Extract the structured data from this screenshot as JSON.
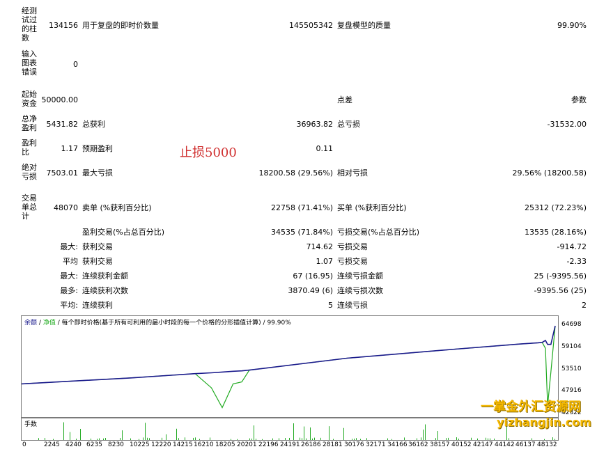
{
  "stats": {
    "bars_tested_label": "经测试过的柱数",
    "bars_tested_value": "134156",
    "ticks_label": "用于复盘的即时价数量",
    "ticks_value": "145505342",
    "quality_label": "复盘模型的质量",
    "quality_value": "99.90%",
    "chart_errors_label": "输入图表错误",
    "chart_errors_value": "0",
    "initial_deposit_label": "起始资金",
    "initial_deposit_value": "50000.00",
    "spread_label": "点差",
    "spread_value": "参数",
    "net_profit_label": "总净盈利",
    "net_profit_value": "5431.82",
    "gross_profit_label": "总获利",
    "gross_profit_value": "36963.82",
    "gross_loss_label": "总亏损",
    "gross_loss_value": "-31532.00",
    "profit_factor_label": "盈利比",
    "profit_factor_value": "1.17",
    "expected_payoff_label": "预期盈利",
    "expected_payoff_value": "0.11",
    "abs_drawdown_label": "绝对亏损",
    "abs_drawdown_value": "7503.01",
    "max_drawdown_label": "最大亏损",
    "max_drawdown_value": "18200.58 (29.56%)",
    "rel_drawdown_label": "相对亏损",
    "rel_drawdown_value": "29.56% (18200.58)",
    "total_trades_label": "交易单总计",
    "total_trades_value": "48070",
    "short_label": "卖单 (%获利百分比)",
    "short_value": "22758 (71.41%)",
    "long_label": "买单 (%获利百分比)",
    "long_value": "25312 (72.23%)",
    "profit_trades_label": "盈利交易(%占总百分比)",
    "profit_trades_value": "34535 (71.84%)",
    "loss_trades_label": "亏损交易(%占总百分比)",
    "loss_trades_value": "13535 (28.16%)",
    "largest_prefix": "最大:",
    "largest_profit_label": "获利交易",
    "largest_profit_value": "714.62",
    "largest_loss_label": "亏损交易",
    "largest_loss_value": "-914.72",
    "average_prefix": "平均",
    "average_profit_label": "获利交易",
    "average_profit_value": "1.07",
    "average_loss_label": "亏损交易",
    "average_loss_value": "-2.33",
    "max_cons_prefix": "最大:",
    "max_cons_wins_label": "连续获利金额",
    "max_cons_wins_value": "67 (16.95)",
    "max_cons_losses_label": "连续亏损金额",
    "max_cons_losses_value": "25 (-9395.56)",
    "maximal_prefix": "最多:",
    "maximal_cons_profit_label": "连续获利次数",
    "maximal_cons_profit_value": "3870.49 (6)",
    "maximal_cons_loss_label": "连续亏损次数",
    "maximal_cons_loss_value": "-9395.56 (25)",
    "avg_cons_prefix": "平均:",
    "avg_cons_wins_label": "连续获利",
    "avg_cons_wins_value": "5",
    "avg_cons_losses_label": "连续亏损",
    "avg_cons_losses_value": "2"
  },
  "annotation": "止损5000",
  "chart": {
    "legend_balance": "余额",
    "legend_sep1": "/",
    "legend_equity": "净值",
    "legend_sep2": "/",
    "legend_model": "每个即时价格(基于所有可利用的最小时段的每一个价格的分形插值计算)",
    "legend_sep3": "/",
    "legend_quality": "99.90%",
    "volume_label": "手数",
    "colors": {
      "balance": "#1a1a8c",
      "equity": "#1faa1f",
      "volume": "#22aa22"
    }
  },
  "chart_data": {
    "type": "line",
    "title": "",
    "x": [
      0,
      10000,
      16000,
      17500,
      18500,
      19500,
      20300,
      21000,
      30000,
      40000,
      46000,
      47600,
      48000,
      48300,
      48500,
      48800,
      49200
    ],
    "series": [
      {
        "name": "余额",
        "values": [
          50000,
          51500,
          52600,
          52800,
          53000,
          53200,
          53300,
          53500,
          56500,
          58800,
          60100,
          60400,
          60500,
          61000,
          60000,
          60000,
          64698
        ]
      },
      {
        "name": "净值",
        "values": [
          50000,
          51500,
          52600,
          49000,
          44000,
          50000,
          50500,
          53500,
          56500,
          58800,
          60100,
          60400,
          60500,
          59000,
          44500,
          53000,
          64698
        ]
      }
    ],
    "yticks": [
      "64698",
      "59104",
      "53510",
      "47916",
      "42322"
    ],
    "xticks": [
      "0",
      "2245",
      "4240",
      "6235",
      "8230",
      "10225",
      "12220",
      "14215",
      "16210",
      "18205",
      "20201",
      "22196",
      "24191",
      "26186",
      "28181",
      "30176",
      "32171",
      "34166",
      "36162",
      "38157",
      "40152",
      "42147",
      "44142",
      "46137",
      "48132"
    ],
    "ylim": [
      42322,
      64698
    ]
  },
  "watermark": {
    "line1": "一掌金外汇资源网",
    "line2": "yizhangjin.com"
  }
}
